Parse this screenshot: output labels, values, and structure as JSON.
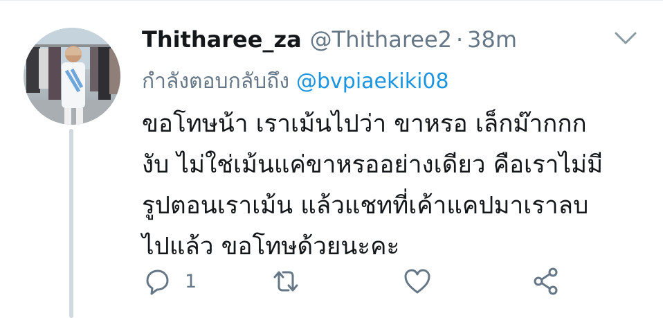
{
  "tweet": {
    "display_name": "Thitharee_za",
    "handle": "@Thitharee2",
    "separator": "·",
    "time": "38m",
    "replying_to_label": "กำลังตอบกลับถึง",
    "replying_to_handle": "@bvpiaekiki08",
    "body_lines": [
      "ขอโทษน้า เราเม้นไปว่า ขาหรอ เล็กม๊ากกก",
      "งับ ไม่ใช่เม้นแค่ขาหรออย่างเดียว คือเราไม่มี",
      "รูปตอนเราเม้น แล้วแชทที่เค้าแคปมาเราลบ",
      "ไปแล้ว ขอโทษด้วยนะคะ"
    ],
    "actions": {
      "reply_icon": "comment-icon",
      "reply_count": "1",
      "retweet_icon": "retweet-icon",
      "like_icon": "heart-icon",
      "share_icon": "share-icon"
    }
  },
  "colors": {
    "text_primary": "#14171a",
    "text_secondary": "#657786",
    "link": "#1b95e0",
    "icon": "#657786",
    "thread_line": "#cfd9de"
  }
}
